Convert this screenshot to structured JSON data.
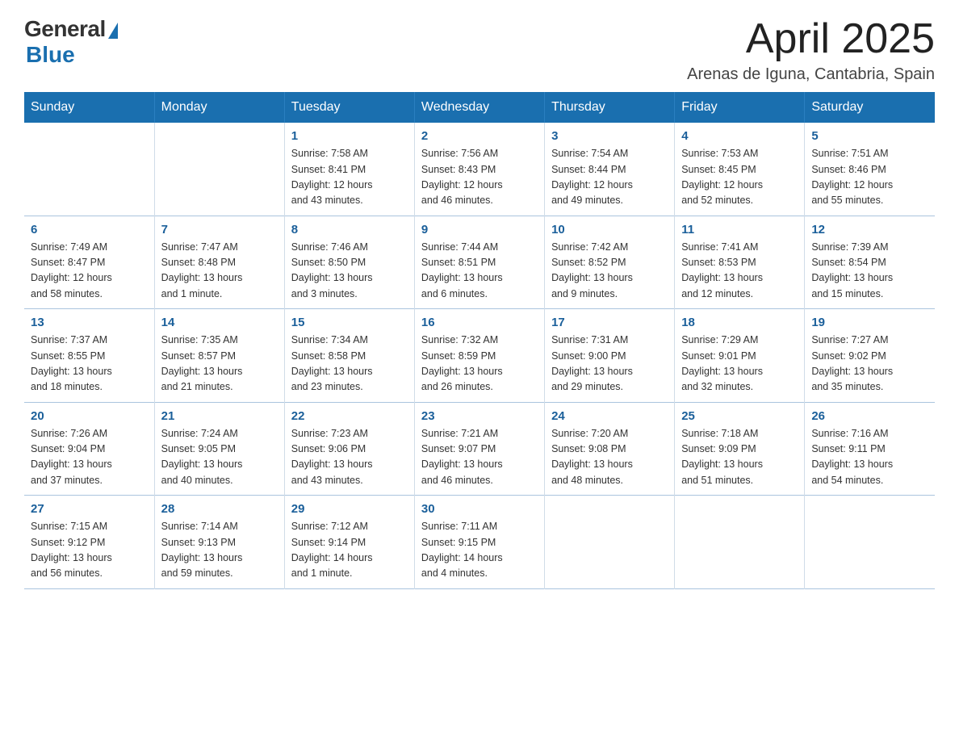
{
  "logo": {
    "general": "General",
    "blue": "Blue"
  },
  "title": "April 2025",
  "subtitle": "Arenas de Iguna, Cantabria, Spain",
  "days_of_week": [
    "Sunday",
    "Monday",
    "Tuesday",
    "Wednesday",
    "Thursday",
    "Friday",
    "Saturday"
  ],
  "weeks": [
    [
      {
        "day": "",
        "info": ""
      },
      {
        "day": "",
        "info": ""
      },
      {
        "day": "1",
        "info": "Sunrise: 7:58 AM\nSunset: 8:41 PM\nDaylight: 12 hours\nand 43 minutes."
      },
      {
        "day": "2",
        "info": "Sunrise: 7:56 AM\nSunset: 8:43 PM\nDaylight: 12 hours\nand 46 minutes."
      },
      {
        "day": "3",
        "info": "Sunrise: 7:54 AM\nSunset: 8:44 PM\nDaylight: 12 hours\nand 49 minutes."
      },
      {
        "day": "4",
        "info": "Sunrise: 7:53 AM\nSunset: 8:45 PM\nDaylight: 12 hours\nand 52 minutes."
      },
      {
        "day": "5",
        "info": "Sunrise: 7:51 AM\nSunset: 8:46 PM\nDaylight: 12 hours\nand 55 minutes."
      }
    ],
    [
      {
        "day": "6",
        "info": "Sunrise: 7:49 AM\nSunset: 8:47 PM\nDaylight: 12 hours\nand 58 minutes."
      },
      {
        "day": "7",
        "info": "Sunrise: 7:47 AM\nSunset: 8:48 PM\nDaylight: 13 hours\nand 1 minute."
      },
      {
        "day": "8",
        "info": "Sunrise: 7:46 AM\nSunset: 8:50 PM\nDaylight: 13 hours\nand 3 minutes."
      },
      {
        "day": "9",
        "info": "Sunrise: 7:44 AM\nSunset: 8:51 PM\nDaylight: 13 hours\nand 6 minutes."
      },
      {
        "day": "10",
        "info": "Sunrise: 7:42 AM\nSunset: 8:52 PM\nDaylight: 13 hours\nand 9 minutes."
      },
      {
        "day": "11",
        "info": "Sunrise: 7:41 AM\nSunset: 8:53 PM\nDaylight: 13 hours\nand 12 minutes."
      },
      {
        "day": "12",
        "info": "Sunrise: 7:39 AM\nSunset: 8:54 PM\nDaylight: 13 hours\nand 15 minutes."
      }
    ],
    [
      {
        "day": "13",
        "info": "Sunrise: 7:37 AM\nSunset: 8:55 PM\nDaylight: 13 hours\nand 18 minutes."
      },
      {
        "day": "14",
        "info": "Sunrise: 7:35 AM\nSunset: 8:57 PM\nDaylight: 13 hours\nand 21 minutes."
      },
      {
        "day": "15",
        "info": "Sunrise: 7:34 AM\nSunset: 8:58 PM\nDaylight: 13 hours\nand 23 minutes."
      },
      {
        "day": "16",
        "info": "Sunrise: 7:32 AM\nSunset: 8:59 PM\nDaylight: 13 hours\nand 26 minutes."
      },
      {
        "day": "17",
        "info": "Sunrise: 7:31 AM\nSunset: 9:00 PM\nDaylight: 13 hours\nand 29 minutes."
      },
      {
        "day": "18",
        "info": "Sunrise: 7:29 AM\nSunset: 9:01 PM\nDaylight: 13 hours\nand 32 minutes."
      },
      {
        "day": "19",
        "info": "Sunrise: 7:27 AM\nSunset: 9:02 PM\nDaylight: 13 hours\nand 35 minutes."
      }
    ],
    [
      {
        "day": "20",
        "info": "Sunrise: 7:26 AM\nSunset: 9:04 PM\nDaylight: 13 hours\nand 37 minutes."
      },
      {
        "day": "21",
        "info": "Sunrise: 7:24 AM\nSunset: 9:05 PM\nDaylight: 13 hours\nand 40 minutes."
      },
      {
        "day": "22",
        "info": "Sunrise: 7:23 AM\nSunset: 9:06 PM\nDaylight: 13 hours\nand 43 minutes."
      },
      {
        "day": "23",
        "info": "Sunrise: 7:21 AM\nSunset: 9:07 PM\nDaylight: 13 hours\nand 46 minutes."
      },
      {
        "day": "24",
        "info": "Sunrise: 7:20 AM\nSunset: 9:08 PM\nDaylight: 13 hours\nand 48 minutes."
      },
      {
        "day": "25",
        "info": "Sunrise: 7:18 AM\nSunset: 9:09 PM\nDaylight: 13 hours\nand 51 minutes."
      },
      {
        "day": "26",
        "info": "Sunrise: 7:16 AM\nSunset: 9:11 PM\nDaylight: 13 hours\nand 54 minutes."
      }
    ],
    [
      {
        "day": "27",
        "info": "Sunrise: 7:15 AM\nSunset: 9:12 PM\nDaylight: 13 hours\nand 56 minutes."
      },
      {
        "day": "28",
        "info": "Sunrise: 7:14 AM\nSunset: 9:13 PM\nDaylight: 13 hours\nand 59 minutes."
      },
      {
        "day": "29",
        "info": "Sunrise: 7:12 AM\nSunset: 9:14 PM\nDaylight: 14 hours\nand 1 minute."
      },
      {
        "day": "30",
        "info": "Sunrise: 7:11 AM\nSunset: 9:15 PM\nDaylight: 14 hours\nand 4 minutes."
      },
      {
        "day": "",
        "info": ""
      },
      {
        "day": "",
        "info": ""
      },
      {
        "day": "",
        "info": ""
      }
    ]
  ]
}
